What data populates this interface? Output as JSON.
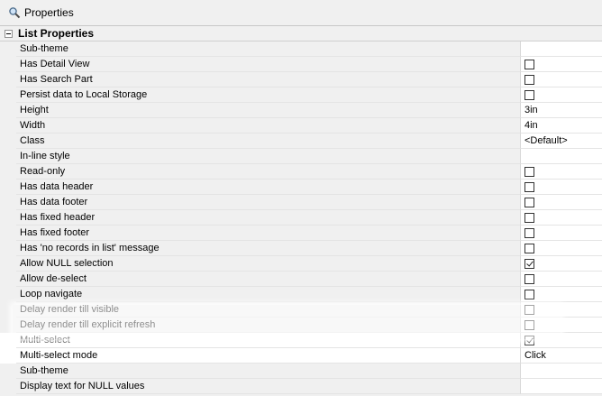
{
  "window": {
    "title": "Properties",
    "title_icon": "search-icon"
  },
  "category": {
    "label": "List Properties",
    "expanded": true
  },
  "rows": [
    {
      "name": "Sub-theme",
      "kind": "text",
      "value": ""
    },
    {
      "name": "Has Detail View",
      "kind": "checkbox",
      "checked": false
    },
    {
      "name": "Has Search Part",
      "kind": "checkbox",
      "checked": false
    },
    {
      "name": "Persist data to Local Storage",
      "kind": "checkbox",
      "checked": false
    },
    {
      "name": "Height",
      "kind": "text",
      "value": "3in"
    },
    {
      "name": "Width",
      "kind": "text",
      "value": "4in"
    },
    {
      "name": "Class",
      "kind": "text",
      "value": "<Default>"
    },
    {
      "name": "In-line style",
      "kind": "text",
      "value": ""
    },
    {
      "name": "Read-only",
      "kind": "checkbox",
      "checked": false
    },
    {
      "name": "Has data header",
      "kind": "checkbox",
      "checked": false
    },
    {
      "name": "Has data footer",
      "kind": "checkbox",
      "checked": false
    },
    {
      "name": "Has fixed header",
      "kind": "checkbox",
      "checked": false
    },
    {
      "name": "Has fixed footer",
      "kind": "checkbox",
      "checked": false
    },
    {
      "name": "Has 'no records in list' message",
      "kind": "checkbox",
      "checked": false
    },
    {
      "name": "Allow NULL selection",
      "kind": "checkbox",
      "checked": true
    },
    {
      "name": "Allow de-select",
      "kind": "checkbox",
      "checked": false
    },
    {
      "name": "Loop navigate",
      "kind": "checkbox",
      "checked": false
    },
    {
      "name": "Delay render till visible",
      "kind": "checkbox",
      "checked": false
    },
    {
      "name": "Delay render till explicit refresh",
      "kind": "checkbox",
      "checked": false
    },
    {
      "name": "Multi-select",
      "kind": "checkbox",
      "checked": true
    },
    {
      "name": "Multi-select mode",
      "kind": "text",
      "value": "Click"
    },
    {
      "name": "Sub-theme",
      "kind": "text",
      "value": ""
    },
    {
      "name": "Display text for NULL values",
      "kind": "text",
      "value": ""
    }
  ]
}
